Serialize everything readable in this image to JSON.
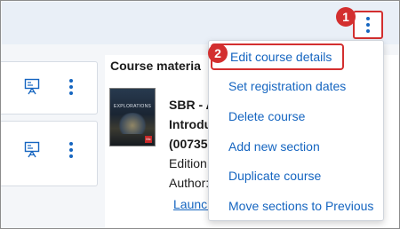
{
  "badges": {
    "step1": "1",
    "step2": "2"
  },
  "materials": {
    "heading": "Course materia",
    "book": {
      "line1": "SBR - A",
      "line2": "Introdu",
      "line3": "(00735",
      "edition_label": "Edition:",
      "author_label": "Author:",
      "launch_link": "Launch"
    }
  },
  "course_menu": {
    "items": [
      "Edit course details",
      "Set registration dates",
      "Delete course",
      "Add new section",
      "Duplicate course",
      "Move sections to Previous"
    ]
  },
  "icons": {
    "course_menu_button": "kebab-vertical-icon",
    "section_card_icon": "presentation-board-icon",
    "section_card_menu": "kebab-vertical-icon"
  },
  "colors": {
    "accent": "#1565c0",
    "highlight": "#d32f2f",
    "topbar": "#e9eff7",
    "background": "#f4f6f9"
  }
}
